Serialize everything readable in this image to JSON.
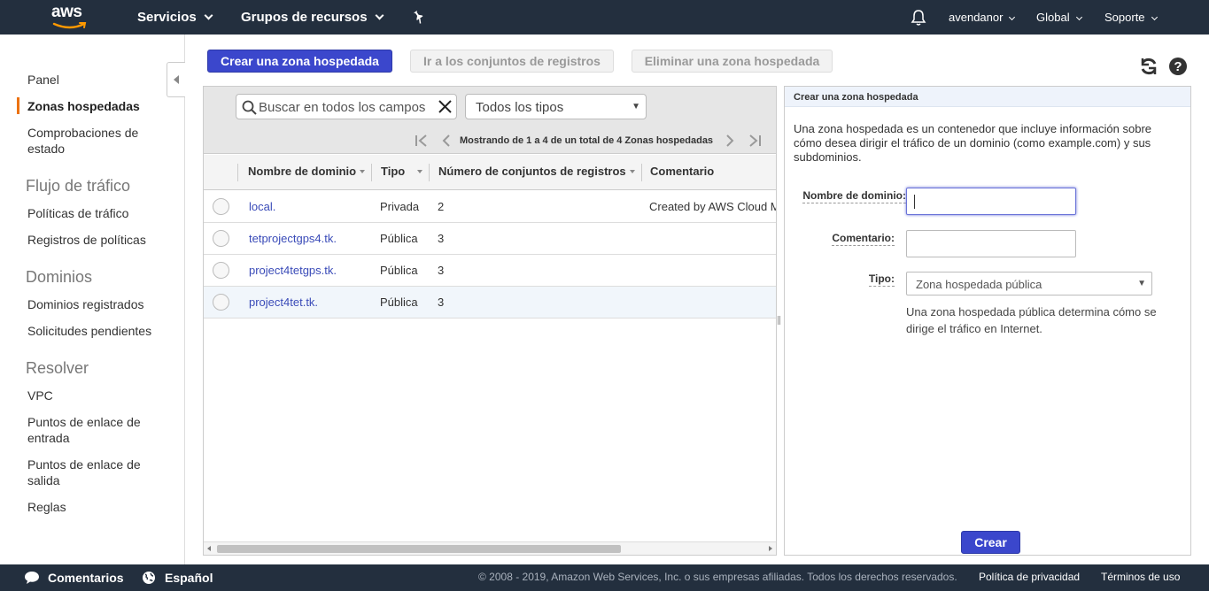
{
  "topnav": {
    "logo_text": "aws",
    "services": "Servicios",
    "resource_groups": "Grupos de recursos",
    "user": "avendanor",
    "region": "Global",
    "support": "Soporte"
  },
  "sidebar": {
    "items": [
      {
        "label": "Panel"
      },
      {
        "label": "Zonas hospedadas"
      },
      {
        "label": "Comprobaciones de estado"
      }
    ],
    "traffic_heading": "Flujo de tráfico",
    "traffic_items": [
      {
        "label": "Políticas de tráfico"
      },
      {
        "label": "Registros de políticas"
      }
    ],
    "domains_heading": "Dominios",
    "domains_items": [
      {
        "label": "Dominios registrados"
      },
      {
        "label": "Solicitudes pendientes"
      }
    ],
    "resolver_heading": "Resolver",
    "resolver_items": [
      {
        "label": "VPC"
      },
      {
        "label": "Puntos de enlace de entrada"
      },
      {
        "label": "Puntos de enlace de salida"
      },
      {
        "label": "Reglas"
      }
    ]
  },
  "toolbar": {
    "create_zone": "Crear una zona hospedada",
    "goto_records": "Ir a los conjuntos de registros",
    "delete_zone": "Eliminar una zona hospedada"
  },
  "filter": {
    "search_placeholder": "Buscar en todos los campos",
    "type_select": "Todos los tipos",
    "pager_text": "Mostrando de 1 a 4 de un total de 4 Zonas hospedadas"
  },
  "table": {
    "columns": [
      "Nombre de dominio",
      "Tipo",
      "Número de conjuntos de registros",
      "Comentario"
    ],
    "rows": [
      {
        "domain": "local.",
        "type": "Privada",
        "records": "2",
        "comment": "Created by AWS Cloud M"
      },
      {
        "domain": "tetprojectgps4.tk.",
        "type": "Pública",
        "records": "3",
        "comment": ""
      },
      {
        "domain": "project4tetgps.tk.",
        "type": "Pública",
        "records": "3",
        "comment": ""
      },
      {
        "domain": "project4tet.tk.",
        "type": "Pública",
        "records": "3",
        "comment": ""
      }
    ]
  },
  "create_panel": {
    "title": "Crear una zona hospedada",
    "description": "Una zona hospedada es un contenedor que incluye información sobre cómo desea dirigir el tráfico de un dominio (como example.com) y sus subdominios.",
    "domain_label": "Nombre de dominio:",
    "domain_value": "",
    "comment_label": "Comentario:",
    "comment_value": "",
    "type_label": "Tipo:",
    "type_value": "Zona hospedada pública",
    "type_help": "Una zona hospedada pública determina cómo se dirige el tráfico en Internet.",
    "submit": "Crear"
  },
  "footer": {
    "feedback": "Comentarios",
    "language": "Español",
    "copyright": "© 2008 - 2019, Amazon Web Services, Inc. o sus empresas afiliadas. Todos los derechos reservados.",
    "privacy": "Política de privacidad",
    "terms": "Términos de uso"
  },
  "colors": {
    "nav_bg": "#232f3e",
    "primary": "#3b47cc",
    "active_bar": "#ec7211",
    "link": "#3a4bb8"
  },
  "icons": [
    "aws-logo-icon",
    "bell-icon",
    "pin-icon",
    "refresh-icon",
    "help-icon",
    "search-icon",
    "clear-icon",
    "first-page-icon",
    "prev-page-icon",
    "next-page-icon",
    "last-page-icon",
    "chat-icon",
    "globe-icon"
  ]
}
